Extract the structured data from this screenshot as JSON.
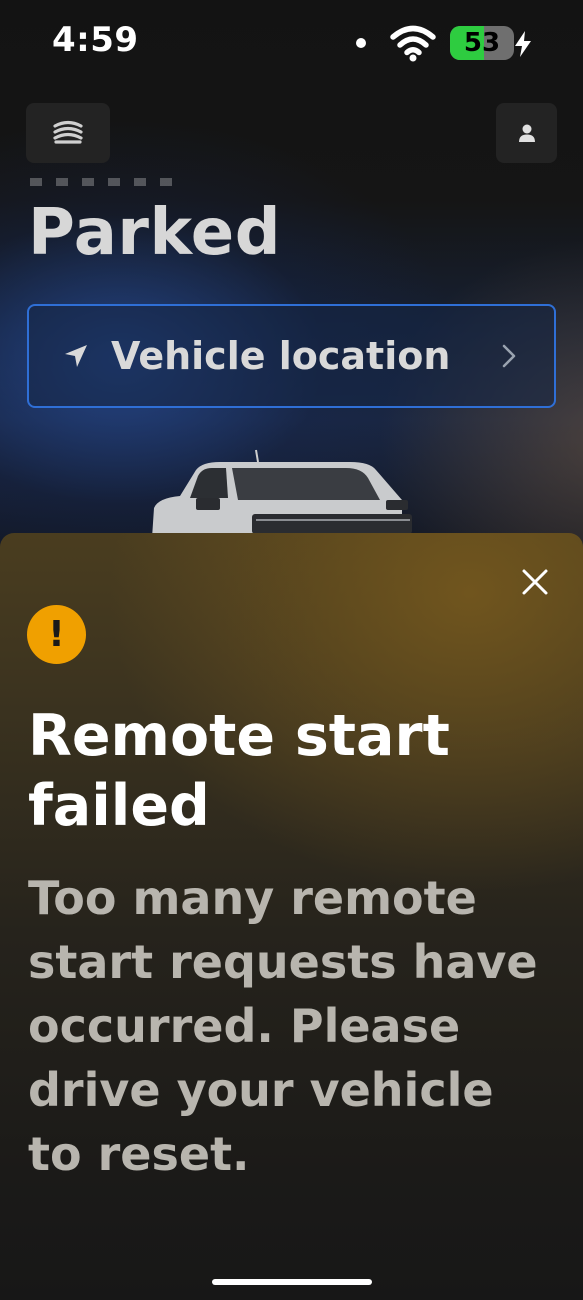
{
  "status_bar": {
    "time": "4:59",
    "battery_percent": "53",
    "battery_level": 0.53,
    "charging": true
  },
  "header": {
    "title": "Parked"
  },
  "location_button": {
    "label": "Vehicle location"
  },
  "alert": {
    "title": "Remote start failed",
    "message": "Too many remote start requests have occurred. Please drive your vehicle to reset.",
    "icon_glyph": "!",
    "icon_color": "#f0a000"
  },
  "colors": {
    "battery_fill": "#2ecc40",
    "location_border": "#2f6fd6"
  }
}
